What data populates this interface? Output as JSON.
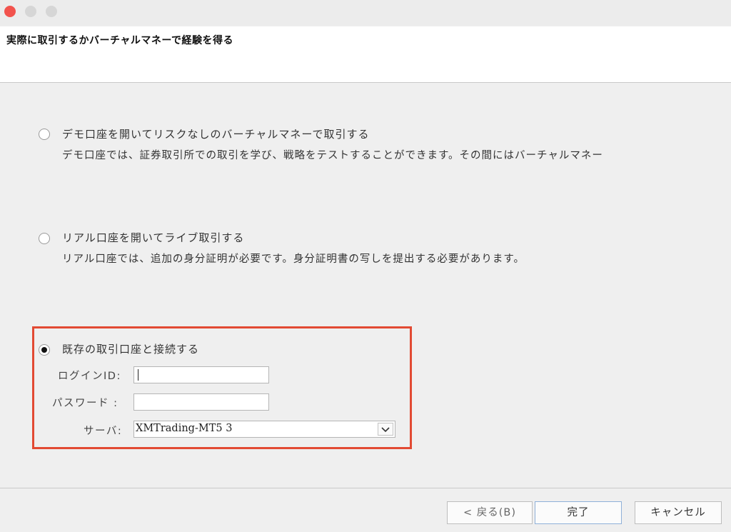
{
  "window": {
    "title": "実際に取引するかバーチャルマネーで経験を得る"
  },
  "options": [
    {
      "label": "デモ口座を開いてリスクなしのバーチャルマネーで取引する",
      "description": "デモ口座では、証券取引所での取引を学び、戦略をテストすることができます。その間にはバーチャルマネー",
      "selected": false
    },
    {
      "label": "リアル口座を開いてライブ取引する",
      "description": "リアル口座では、追加の身分証明が必要です。身分証明書の写しを提出する必要があります。",
      "selected": false
    },
    {
      "label": "既存の取引口座と接続する",
      "selected": true
    }
  ],
  "login": {
    "login_label": "ログインID:",
    "login_value": "",
    "password_label": "パスワード :",
    "password_value": "",
    "server_label": "サーバ:",
    "server_value": "XMTrading-MT5 3"
  },
  "buttons": {
    "back": "< 戻る(B)",
    "finish": "完了",
    "cancel": "キャンセル"
  },
  "colors": {
    "highlight": "#e24a33",
    "close": "#f2534d"
  },
  "icons": [
    "close-icon",
    "minimize-icon",
    "maximize-icon",
    "chevron-down-icon"
  ]
}
